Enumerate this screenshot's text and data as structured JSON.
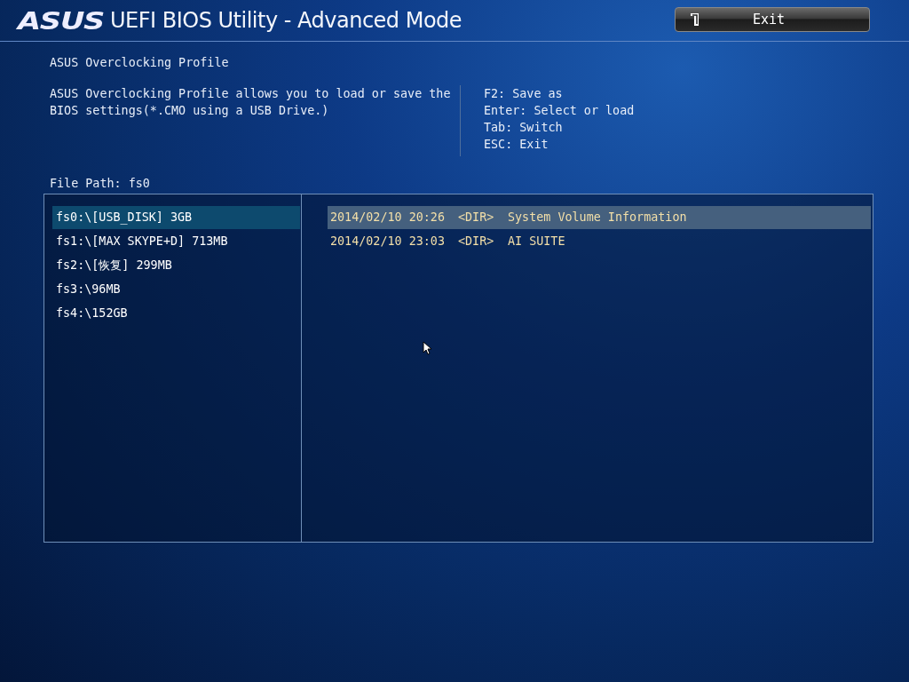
{
  "header": {
    "logo": "ASUS",
    "title": "UEFI BIOS Utility - Advanced Mode",
    "exit_button": "Exit"
  },
  "page_title": "ASUS Overclocking Profile",
  "description": "ASUS Overclocking Profile allows you to load or save the BIOS settings(*.CMO using a USB Drive.)",
  "key_hints": [
    "F2: Save as",
    "Enter: Select or load",
    "Tab: Switch",
    "ESC: Exit"
  ],
  "file_path": "File Path: fs0",
  "drives": [
    {
      "label": "fs0:\\[USB_DISK] 3GB",
      "selected": true
    },
    {
      "label": "fs1:\\[MAX SKYPE+D] 713MB",
      "selected": false
    },
    {
      "label": "fs2:\\[恢复] 299MB",
      "selected": false
    },
    {
      "label": "fs3:\\96MB",
      "selected": false
    },
    {
      "label": "fs4:\\152GB",
      "selected": false
    }
  ],
  "files": [
    {
      "date": "2014/02/10 20:26",
      "type": "<DIR>",
      "name": "System Volume Information",
      "selected": true
    },
    {
      "date": "2014/02/10 23:03",
      "type": "<DIR>",
      "name": "AI SUITE",
      "selected": false
    }
  ]
}
